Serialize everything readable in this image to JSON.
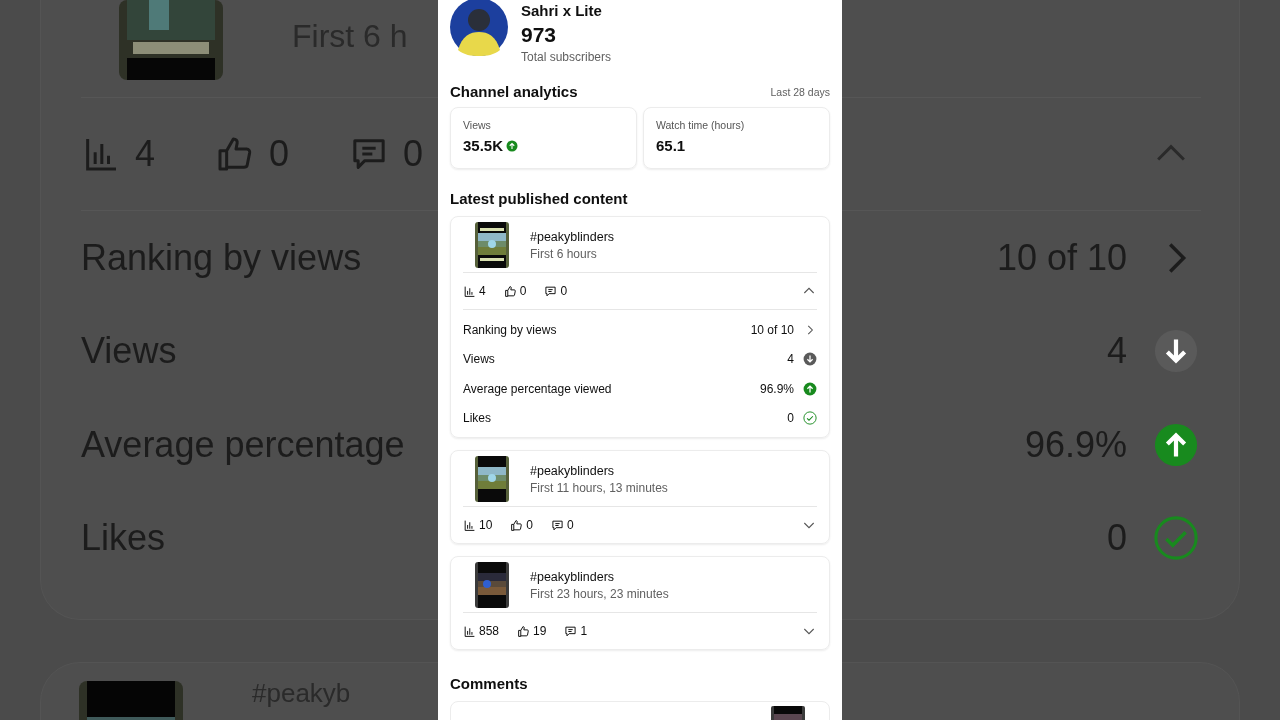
{
  "backdrop": {
    "video": {
      "subtitle": "First 6 h",
      "expanded": true,
      "stats": [
        {
          "kind": "views",
          "value": "4"
        },
        {
          "kind": "likes",
          "value": "0"
        },
        {
          "kind": "comments",
          "value": "0"
        }
      ],
      "metrics": [
        {
          "label": "Ranking by views",
          "value": "10 of 10",
          "kind": "link"
        },
        {
          "label": "Views",
          "value": "4",
          "kind": "down"
        },
        {
          "label": "Average percentage",
          "value": "96.9%",
          "kind": "up"
        },
        {
          "label": "Likes",
          "value": "0",
          "kind": "check"
        }
      ]
    },
    "next_video": {
      "title": "#peakyb"
    }
  },
  "channel": {
    "name": "Sahri x Lite",
    "subscribers": "973",
    "subscribers_label": "Total subscribers"
  },
  "analytics": {
    "title": "Channel analytics",
    "period": "Last 28 days",
    "cards": [
      {
        "label": "Views",
        "value": "35.5K",
        "kind": "up"
      },
      {
        "label": "Watch time (hours)",
        "value": "65.1"
      }
    ]
  },
  "latest": {
    "title": "Latest published content",
    "videos": [
      {
        "title": "#peakyblinders",
        "subtitle": "First 6 hours",
        "expanded": true,
        "stats": [
          {
            "kind": "views",
            "value": "4"
          },
          {
            "kind": "likes",
            "value": "0"
          },
          {
            "kind": "comments",
            "value": "0"
          }
        ],
        "metrics": [
          {
            "label": "Ranking by views",
            "value": "10 of 10",
            "kind": "link"
          },
          {
            "label": "Views",
            "value": "4",
            "kind": "down"
          },
          {
            "label": "Average percentage viewed",
            "value": "96.9%",
            "kind": "up"
          },
          {
            "label": "Likes",
            "value": "0",
            "kind": "check"
          }
        ]
      },
      {
        "title": "#peakyblinders",
        "subtitle": "First 11 hours, 13 minutes",
        "expanded": false,
        "stats": [
          {
            "kind": "views",
            "value": "10"
          },
          {
            "kind": "likes",
            "value": "0"
          },
          {
            "kind": "comments",
            "value": "0"
          }
        ]
      },
      {
        "title": "#peakyblinders",
        "subtitle": "First 23 hours, 23 minutes",
        "expanded": false,
        "stats": [
          {
            "kind": "views",
            "value": "858"
          },
          {
            "kind": "likes",
            "value": "19"
          },
          {
            "kind": "comments",
            "value": "1"
          }
        ]
      }
    ]
  },
  "comments": {
    "title": "Comments"
  }
}
